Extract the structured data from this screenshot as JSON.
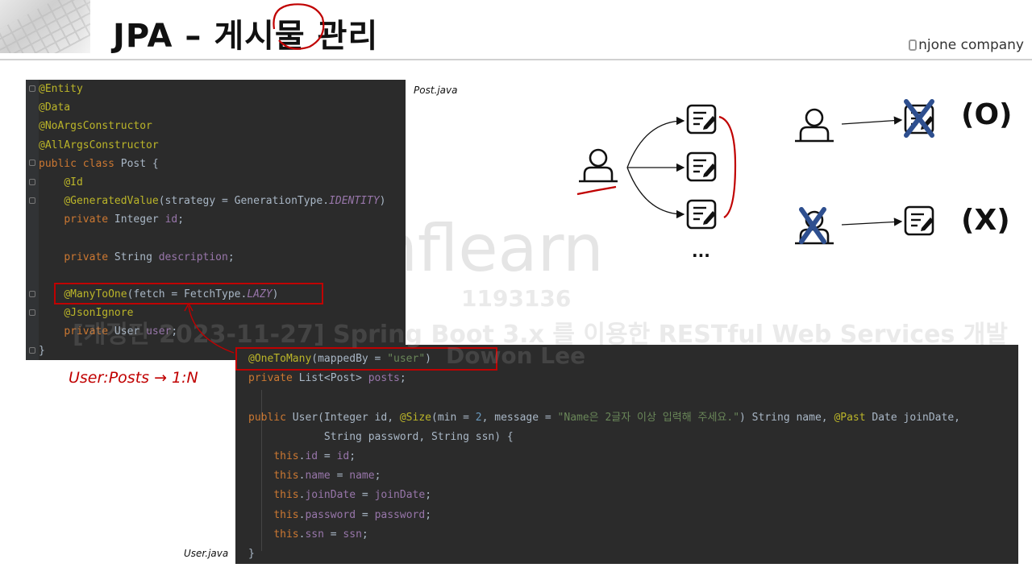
{
  "header": {
    "title": "JPA – 게시물 관리",
    "brand": "njone company"
  },
  "post_code": {
    "file_label": "Post.java",
    "lines": [
      "@Entity",
      "@Data",
      "@NoArgsConstructor",
      "@AllArgsConstructor",
      "public class Post {",
      "    @Id",
      "    @GeneratedValue(strategy = GenerationType.IDENTITY)",
      "    private Integer id;",
      "",
      "    private String description;",
      "",
      "    @ManyToOne(fetch = FetchType.LAZY)",
      "    @JsonIgnore",
      "    private User user;",
      "}"
    ]
  },
  "user_code": {
    "file_label": "User.java",
    "lines": [
      "@OneToMany(mappedBy = \"user\")",
      "private List<Post> posts;",
      "",
      "public User(Integer id, @Size(min = 2, message = \"Name은 2글자 이상 입력해 주세요.\") String name, @Past Date joinDate,",
      "            String password, String ssn) {",
      "    this.id = id;",
      "    this.name = name;",
      "    this.joinDate = joinDate;",
      "    this.password = password;",
      "    this.ssn = ssn;",
      "}"
    ]
  },
  "relation_label": "User:Posts → 1:N",
  "diagram": {
    "ellipsis": "...",
    "valid_mark": "(O)",
    "invalid_mark": "(X)"
  },
  "watermark": {
    "logo": "inflearn",
    "id": "1193136",
    "course": "[개정판 2023-11-27] Spring Boot 3.x 를 이용한 RESTful Web Services 개발",
    "user": "Dowon Lee"
  },
  "colors": {
    "highlight": "#c00000",
    "code_bg": "#2b2b2b",
    "annotation": "#bbb529",
    "keyword": "#cc7832",
    "field": "#9876aa",
    "string": "#6a8759",
    "cross": "#2e4f8f"
  }
}
